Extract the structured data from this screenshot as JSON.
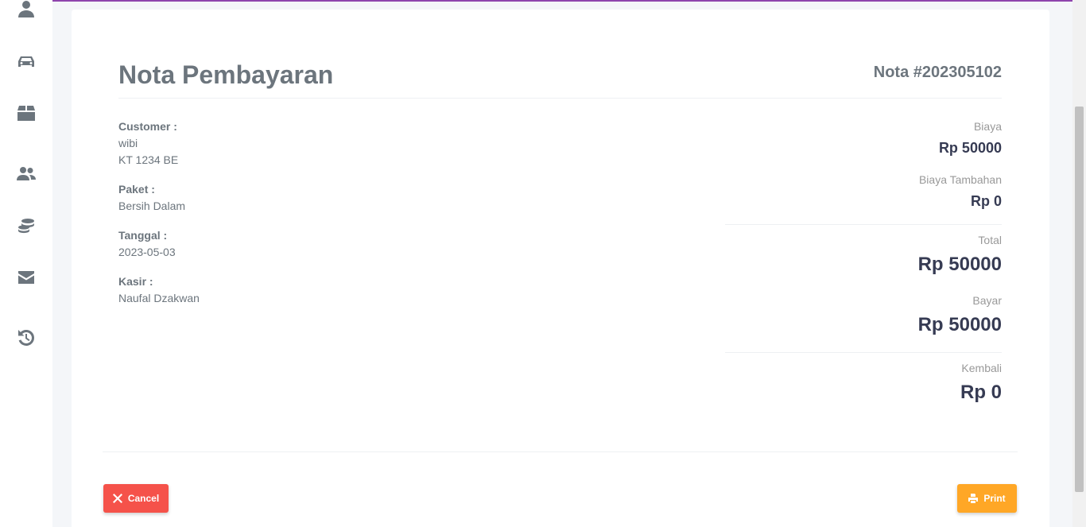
{
  "sidebar": {
    "items": [
      {
        "icon": "user-icon"
      },
      {
        "icon": "car-icon"
      },
      {
        "icon": "box-icon"
      },
      {
        "icon": "users-icon"
      },
      {
        "icon": "coins-icon"
      },
      {
        "icon": "envelope-icon"
      },
      {
        "icon": "history-icon"
      }
    ]
  },
  "invoice": {
    "title": "Nota Pembayaran",
    "number": "Nota #202305102",
    "customer_label": "Customer :",
    "customer_name": "wibi",
    "customer_plate": "KT 1234 BE",
    "package_label": "Paket :",
    "package_value": "Bersih Dalam",
    "date_label": "Tanggal :",
    "date_value": "2023-05-03",
    "cashier_label": "Kasir :",
    "cashier_value": "Naufal Dzakwan"
  },
  "summary": {
    "fee_label": "Biaya",
    "fee_value": "Rp 50000",
    "extra_label": "Biaya Tambahan",
    "extra_value": "Rp 0",
    "total_label": "Total",
    "total_value": "Rp 50000",
    "paid_label": "Bayar",
    "paid_value": "Rp 50000",
    "change_label": "Kembali",
    "change_value": "Rp 0"
  },
  "actions": {
    "cancel_label": "Cancel",
    "print_label": "Print"
  },
  "colors": {
    "accent_line": "#8e44ad",
    "cancel": "#f5524a",
    "print": "#ffa726"
  }
}
